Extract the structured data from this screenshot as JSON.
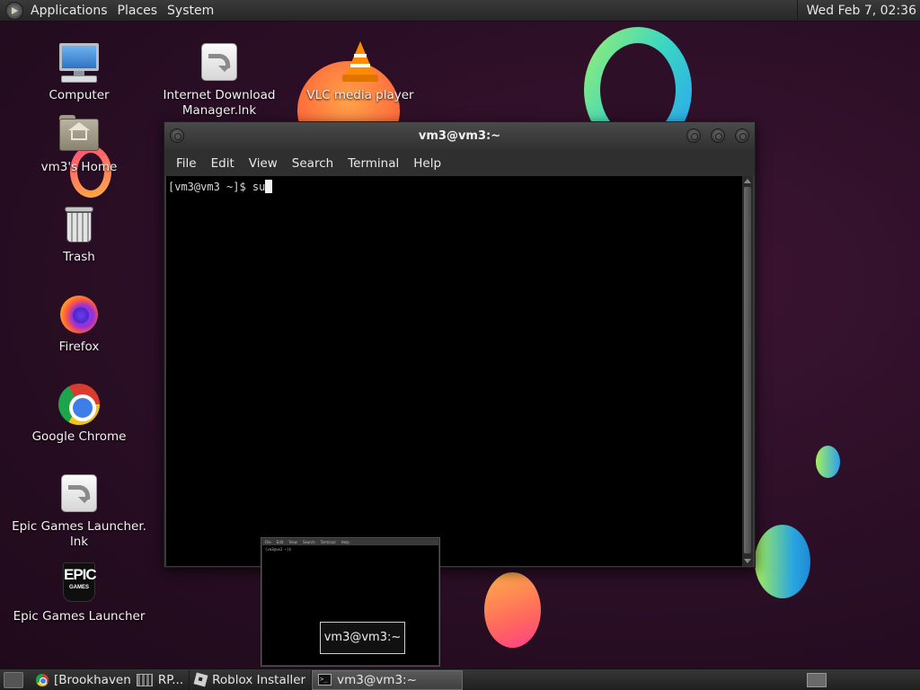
{
  "top_panel": {
    "menus": [
      "Applications",
      "Places",
      "System"
    ],
    "clock": "Wed Feb  7, 02:36"
  },
  "desktop_icons": {
    "computer": "Computer",
    "idm_line1": "Internet Download",
    "idm_line2": "Manager.lnk",
    "vlc": "VLC media player",
    "home": "vm3's Home",
    "trash": "Trash",
    "firefox": "Firefox",
    "chrome": "Google Chrome",
    "epic_lnk_line1": "Epic Games Launcher.",
    "epic_lnk_line2": "lnk",
    "epic": "Epic Games Launcher",
    "epic_logo_top": "EPIC",
    "epic_logo_bottom": "GAMES"
  },
  "terminal": {
    "title": "vm3@vm3:~",
    "menu": [
      "File",
      "Edit",
      "View",
      "Search",
      "Terminal",
      "Help"
    ],
    "prompt_line": "[vm3@vm3 ~]$ su"
  },
  "preview": {
    "label": "vm3@vm3:~",
    "mini_menu": [
      "File",
      "Edit",
      "View",
      "Search",
      "Terminal",
      "Help"
    ],
    "mini_line": "[vm3@vm3 ~]$"
  },
  "taskbar": {
    "items": [
      {
        "label": "[Brookhaven",
        "suffix": "RP..."
      },
      {
        "label": "Roblox Installer"
      },
      {
        "label": "vm3@vm3:~"
      }
    ]
  },
  "colors": {
    "background": "#2a0f23",
    "panel": "#2c2c2c",
    "terminal_bg": "#000000"
  }
}
